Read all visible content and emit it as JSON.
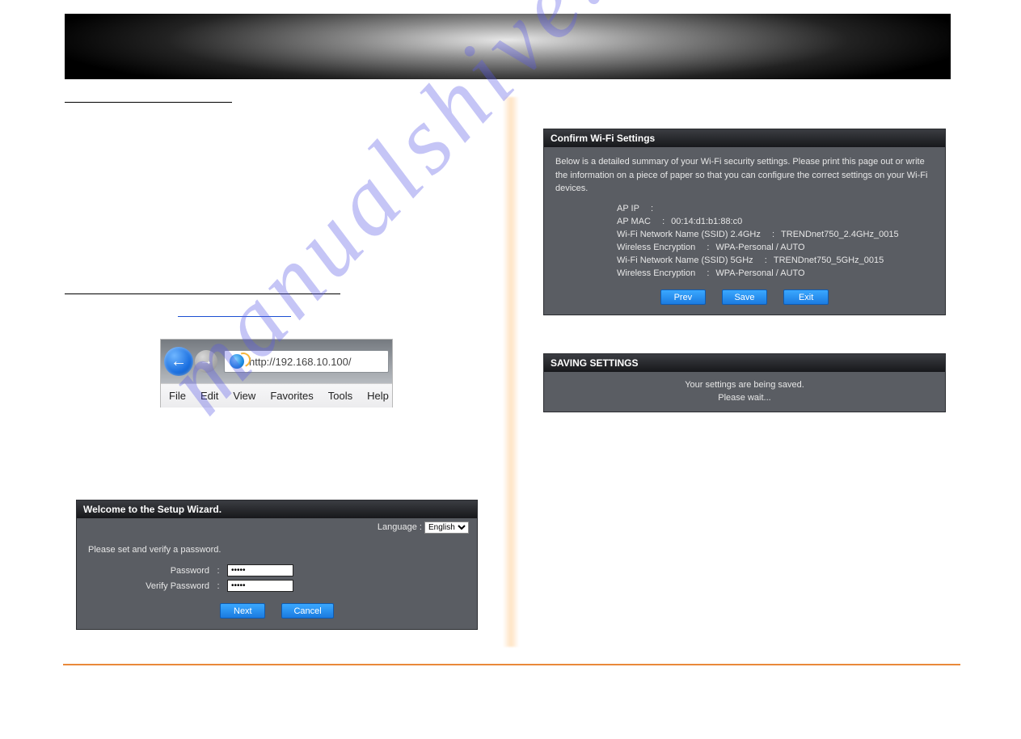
{
  "watermark": "manualshive.",
  "left": {
    "heading1": "",
    "heading2": "",
    "url_text": "http://192.168.10.100/",
    "menus": [
      "File",
      "Edit",
      "View",
      "Favorites",
      "Tools",
      "Help"
    ]
  },
  "wizard": {
    "title": "Welcome to the Setup Wizard.",
    "lang_label": "Language :",
    "lang_value": "English",
    "instruction": "Please set and verify a password.",
    "pw_label": "Password",
    "vpw_label": "Verify Password",
    "pw_value": "•••••",
    "vpw_value": "•••••",
    "next": "Next",
    "cancel": "Cancel"
  },
  "confirm": {
    "title": "Confirm Wi-Fi Settings",
    "intro": "Below is a detailed summary of your Wi-Fi security settings. Please print this page out or write the information on a piece of paper so that you can configure the correct settings on your Wi-Fi devices.",
    "rows": [
      {
        "k": "AP IP",
        "v": ""
      },
      {
        "k": "AP MAC",
        "v": "00:14:d1:b1:88:c0"
      },
      {
        "k": "Wi-Fi Network Name (SSID) 2.4GHz",
        "v": "TRENDnet750_2.4GHz_0015"
      },
      {
        "k": "Wireless Encryption",
        "v": "WPA-Personal / AUTO"
      },
      {
        "k": "Wi-Fi Network Name (SSID) 5GHz",
        "v": "TRENDnet750_5GHz_0015"
      },
      {
        "k": "Wireless Encryption",
        "v": "WPA-Personal / AUTO"
      }
    ],
    "prev": "Prev",
    "save": "Save",
    "exit": "Exit"
  },
  "saving": {
    "title": "SAVING SETTINGS",
    "line1": "Your settings are being saved.",
    "line2": "Please wait..."
  }
}
